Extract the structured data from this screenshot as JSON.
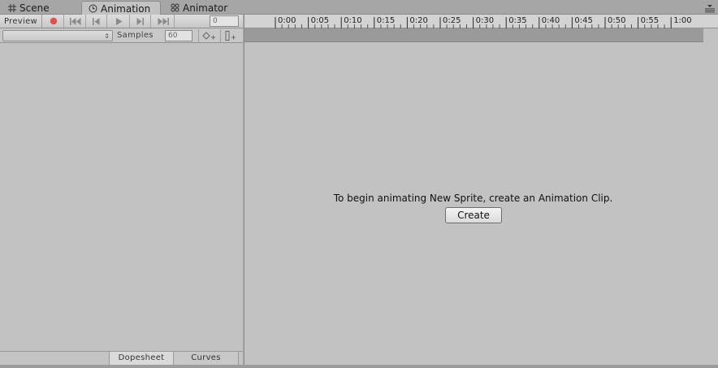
{
  "tabs": [
    {
      "label": "Scene",
      "icon": "grid-icon",
      "active": false
    },
    {
      "label": "Animation",
      "icon": "clock-icon",
      "active": true
    },
    {
      "label": "Animator",
      "icon": "animator-icon",
      "active": false
    }
  ],
  "toolbar": {
    "preview_label": "Preview",
    "frame_value": "0",
    "buttons": [
      "record-icon",
      "first-key-icon",
      "prev-key-icon",
      "play-icon",
      "next-key-icon",
      "last-key-icon"
    ]
  },
  "clip_selector": {
    "selected": "",
    "samples_label": "Samples",
    "samples_value": "60"
  },
  "ruler": {
    "labels": [
      "0:00",
      "0:05",
      "0:10",
      "0:15",
      "0:20",
      "0:25",
      "0:30",
      "0:35",
      "0:40",
      "0:45",
      "0:50",
      "0:55",
      "1:00"
    ]
  },
  "bottom_tabs": {
    "dopesheet_label": "Dopesheet",
    "curves_label": "Curves",
    "active": "Dopesheet"
  },
  "message": "To begin animating New Sprite, create an Animation Clip.",
  "create_label": "Create",
  "colors": {
    "record": "#d9534f",
    "panel": "#c2c2c2",
    "tabbar": "#a6a6a6"
  }
}
